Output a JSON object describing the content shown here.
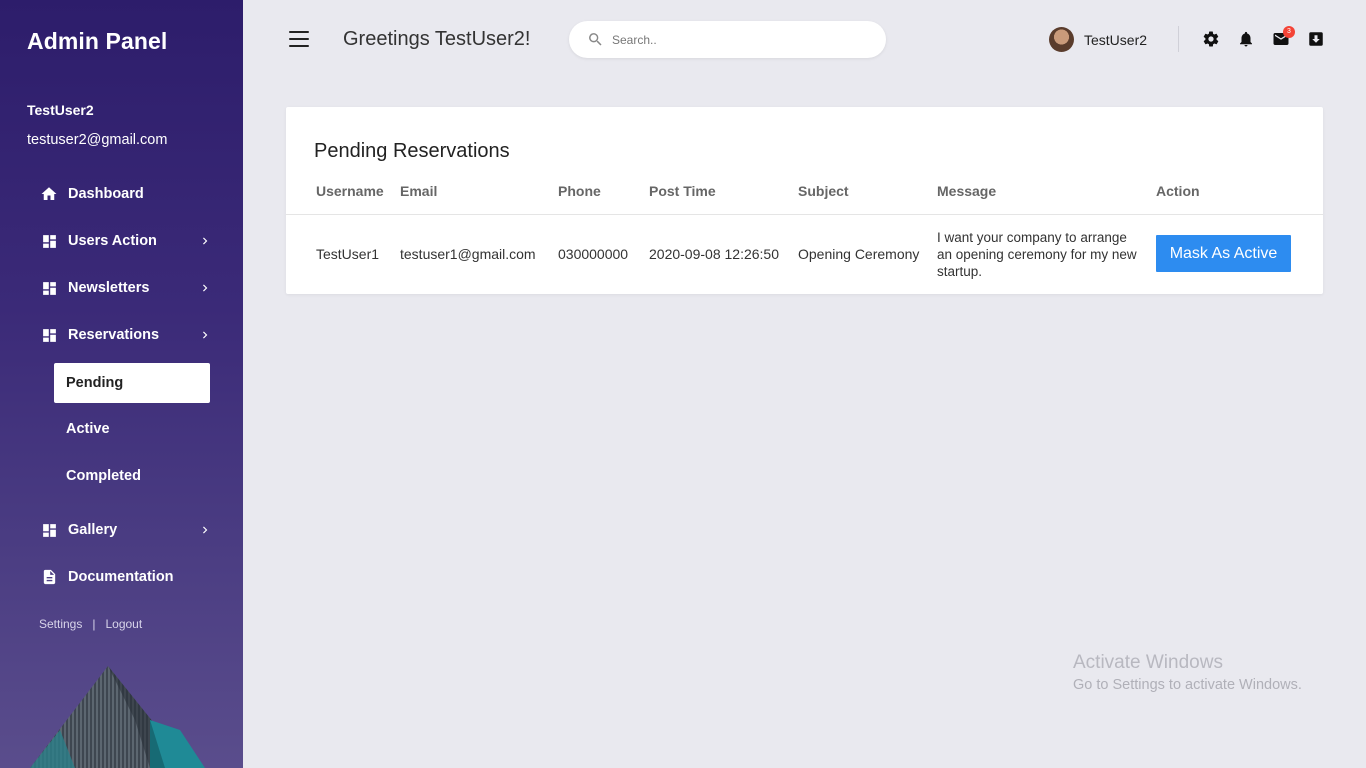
{
  "sidebar": {
    "brand": "Admin Panel",
    "user_name": "TestUser2",
    "user_email": "testuser2@gmail.com",
    "items": [
      {
        "label": "Dashboard",
        "icon": "home-icon"
      },
      {
        "label": "Users Action",
        "icon": "grid-icon"
      },
      {
        "label": "Newsletters",
        "icon": "grid-icon"
      },
      {
        "label": "Reservations",
        "icon": "grid-icon"
      },
      {
        "label": "Gallery",
        "icon": "grid-icon"
      },
      {
        "label": "Documentation",
        "icon": "document-icon"
      }
    ],
    "reservations_sub": [
      {
        "label": "Pending",
        "active": true
      },
      {
        "label": "Active",
        "active": false
      },
      {
        "label": "Completed",
        "active": false
      }
    ],
    "footer": {
      "settings": "Settings",
      "separator": "|",
      "logout": "Logout"
    }
  },
  "header": {
    "greeting": "Greetings TestUser2!",
    "search_placeholder": "Search..",
    "profile_name": "TestUser2",
    "mail_badge": "3"
  },
  "main": {
    "card_title": "Pending Reservations",
    "columns": [
      "Username",
      "Email",
      "Phone",
      "Post Time",
      "Subject",
      "Message",
      "Action"
    ],
    "rows": [
      {
        "username": "TestUser1",
        "email": "testuser1@gmail.com",
        "phone": "030000000",
        "post_time": "2020-09-08 12:26:50",
        "subject": "Opening Ceremony",
        "message": "I want your company to arrange an opening ceremony for my new startup.",
        "action_label": "Mask As Active"
      }
    ]
  },
  "watermark": {
    "title": "Activate Windows",
    "subtitle": "Go to Settings to activate Windows."
  },
  "colors": {
    "sidebar_top": "#2d1d6b",
    "sidebar_bottom": "#5a4d8c",
    "background": "#e9e9ef",
    "accent": "#2d8cf0",
    "badge": "#f44336"
  }
}
